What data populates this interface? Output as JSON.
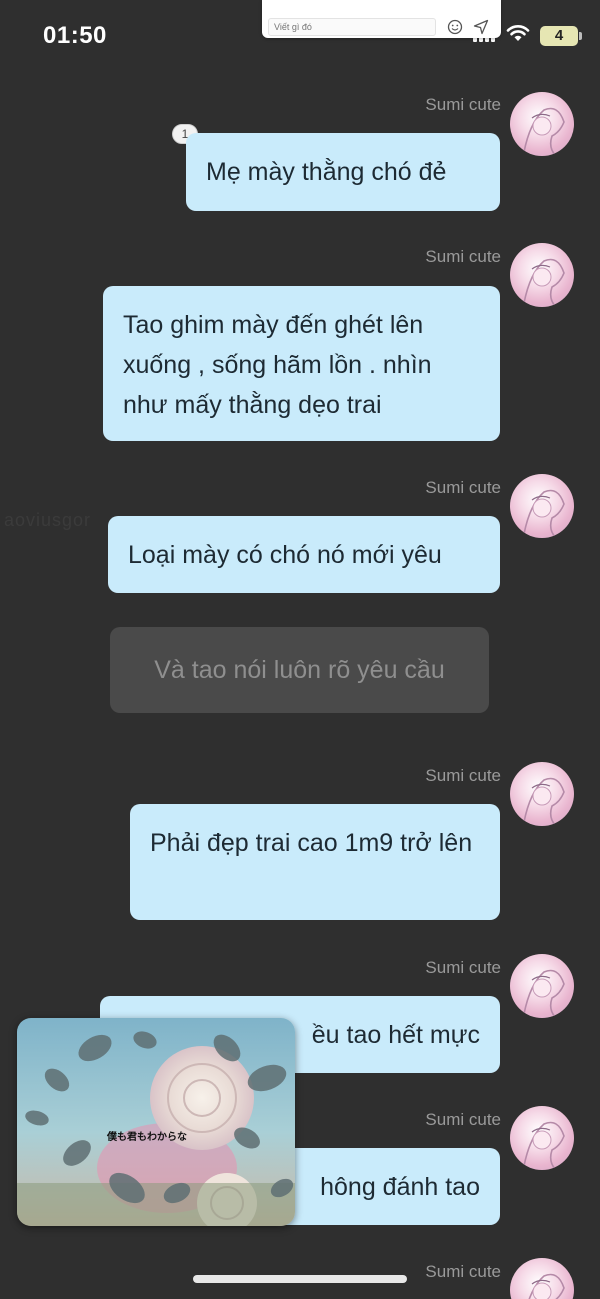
{
  "status_bar": {
    "time": "01:50",
    "battery": "4"
  },
  "reply": {
    "placeholder": "Viết gì đó"
  },
  "ghost_text": "aoviusgor",
  "messages": [
    {
      "sender": "Sumi cute",
      "read_count": "1",
      "text": "Mẹ mày thằng chó đẻ"
    },
    {
      "sender": "Sumi cute",
      "text": "Tao ghim mày đến ghét lên xuống , sống hãm lồn . nhìn như mấy thằng dẹo trai"
    },
    {
      "sender": "Sumi cute",
      "text": "Loại mày có chó nó mới yêu"
    },
    {
      "sender": "Sumi cute",
      "text": "Phải đẹp trai cao 1m9 trở lên"
    },
    {
      "sender": "Sumi cute",
      "text": "ều tao hết mực"
    },
    {
      "sender": "Sumi cute",
      "text": "hông đánh tao"
    },
    {
      "sender": "Sumi cute",
      "text": ""
    }
  ],
  "system_message": "Và tao nói luôn rõ yêu cầu",
  "video": {
    "caption": "僕も君もわからな"
  },
  "colors": {
    "background": "#2f2f2f",
    "bubble": "#c9ebfb",
    "system_bubble": "#4a4a4a"
  }
}
